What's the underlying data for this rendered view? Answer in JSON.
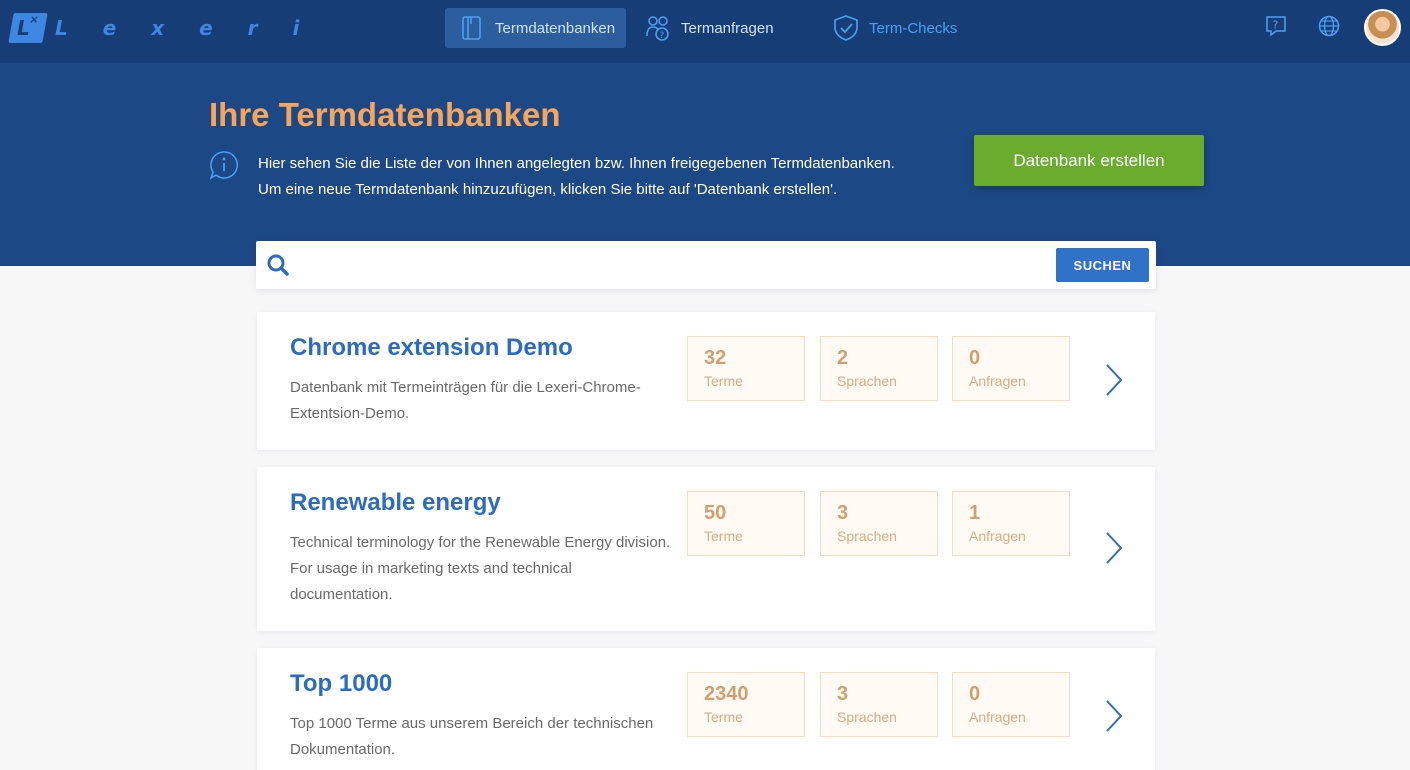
{
  "header": {
    "logo_text": "LEXERI",
    "nav": [
      {
        "label": "Termdatenbanken",
        "icon": "document-icon",
        "active": true
      },
      {
        "label": "Termanfragen",
        "icon": "users-question-icon",
        "active": false
      },
      {
        "label": "Term-Checks",
        "icon": "shield-check-icon",
        "active": false
      }
    ],
    "right_icons": [
      "help-icon",
      "globe-icon",
      "avatar"
    ]
  },
  "hero": {
    "title": "Ihre Termdatenbanken",
    "description": "Hier sehen Sie die Liste der von Ihnen angelegten bzw. Ihnen freigegebenen Termdatenbanken. Um eine neue Termdatenbank hinzuzufügen, klicken Sie bitte auf 'Datenbank erstellen'.",
    "create_button": "Datenbank erstellen"
  },
  "search": {
    "placeholder": "",
    "value": "",
    "button": "SUCHEN"
  },
  "databases": [
    {
      "title": "Chrome extension Demo",
      "description": "Datenbank mit Termeinträgen für die Lexeri-Chrome-Extentsion-Demo.",
      "stats": [
        {
          "value": "32",
          "label": "Terme"
        },
        {
          "value": "2",
          "label": "Sprachen"
        },
        {
          "value": "0",
          "label": "Anfragen"
        }
      ]
    },
    {
      "title": "Renewable energy",
      "description": "Technical terminology for the Renewable Energy division. For usage in marketing texts and technical documentation.",
      "stats": [
        {
          "value": "50",
          "label": "Terme"
        },
        {
          "value": "3",
          "label": "Sprachen"
        },
        {
          "value": "1",
          "label": "Anfragen"
        }
      ]
    },
    {
      "title": "Top 1000",
      "description": "Top 1000 Terme aus unserem Bereich der technischen Dokumentation.",
      "stats": [
        {
          "value": "2340",
          "label": "Terme"
        },
        {
          "value": "3",
          "label": "Sprachen"
        },
        {
          "value": "0",
          "label": "Anfragen"
        }
      ]
    }
  ],
  "colors": {
    "topbar": "#173d77",
    "hero": "#1d4886",
    "accent_orange": "#f5a55c",
    "create_green": "#69ac2e",
    "link_blue": "#2c6cc0"
  }
}
